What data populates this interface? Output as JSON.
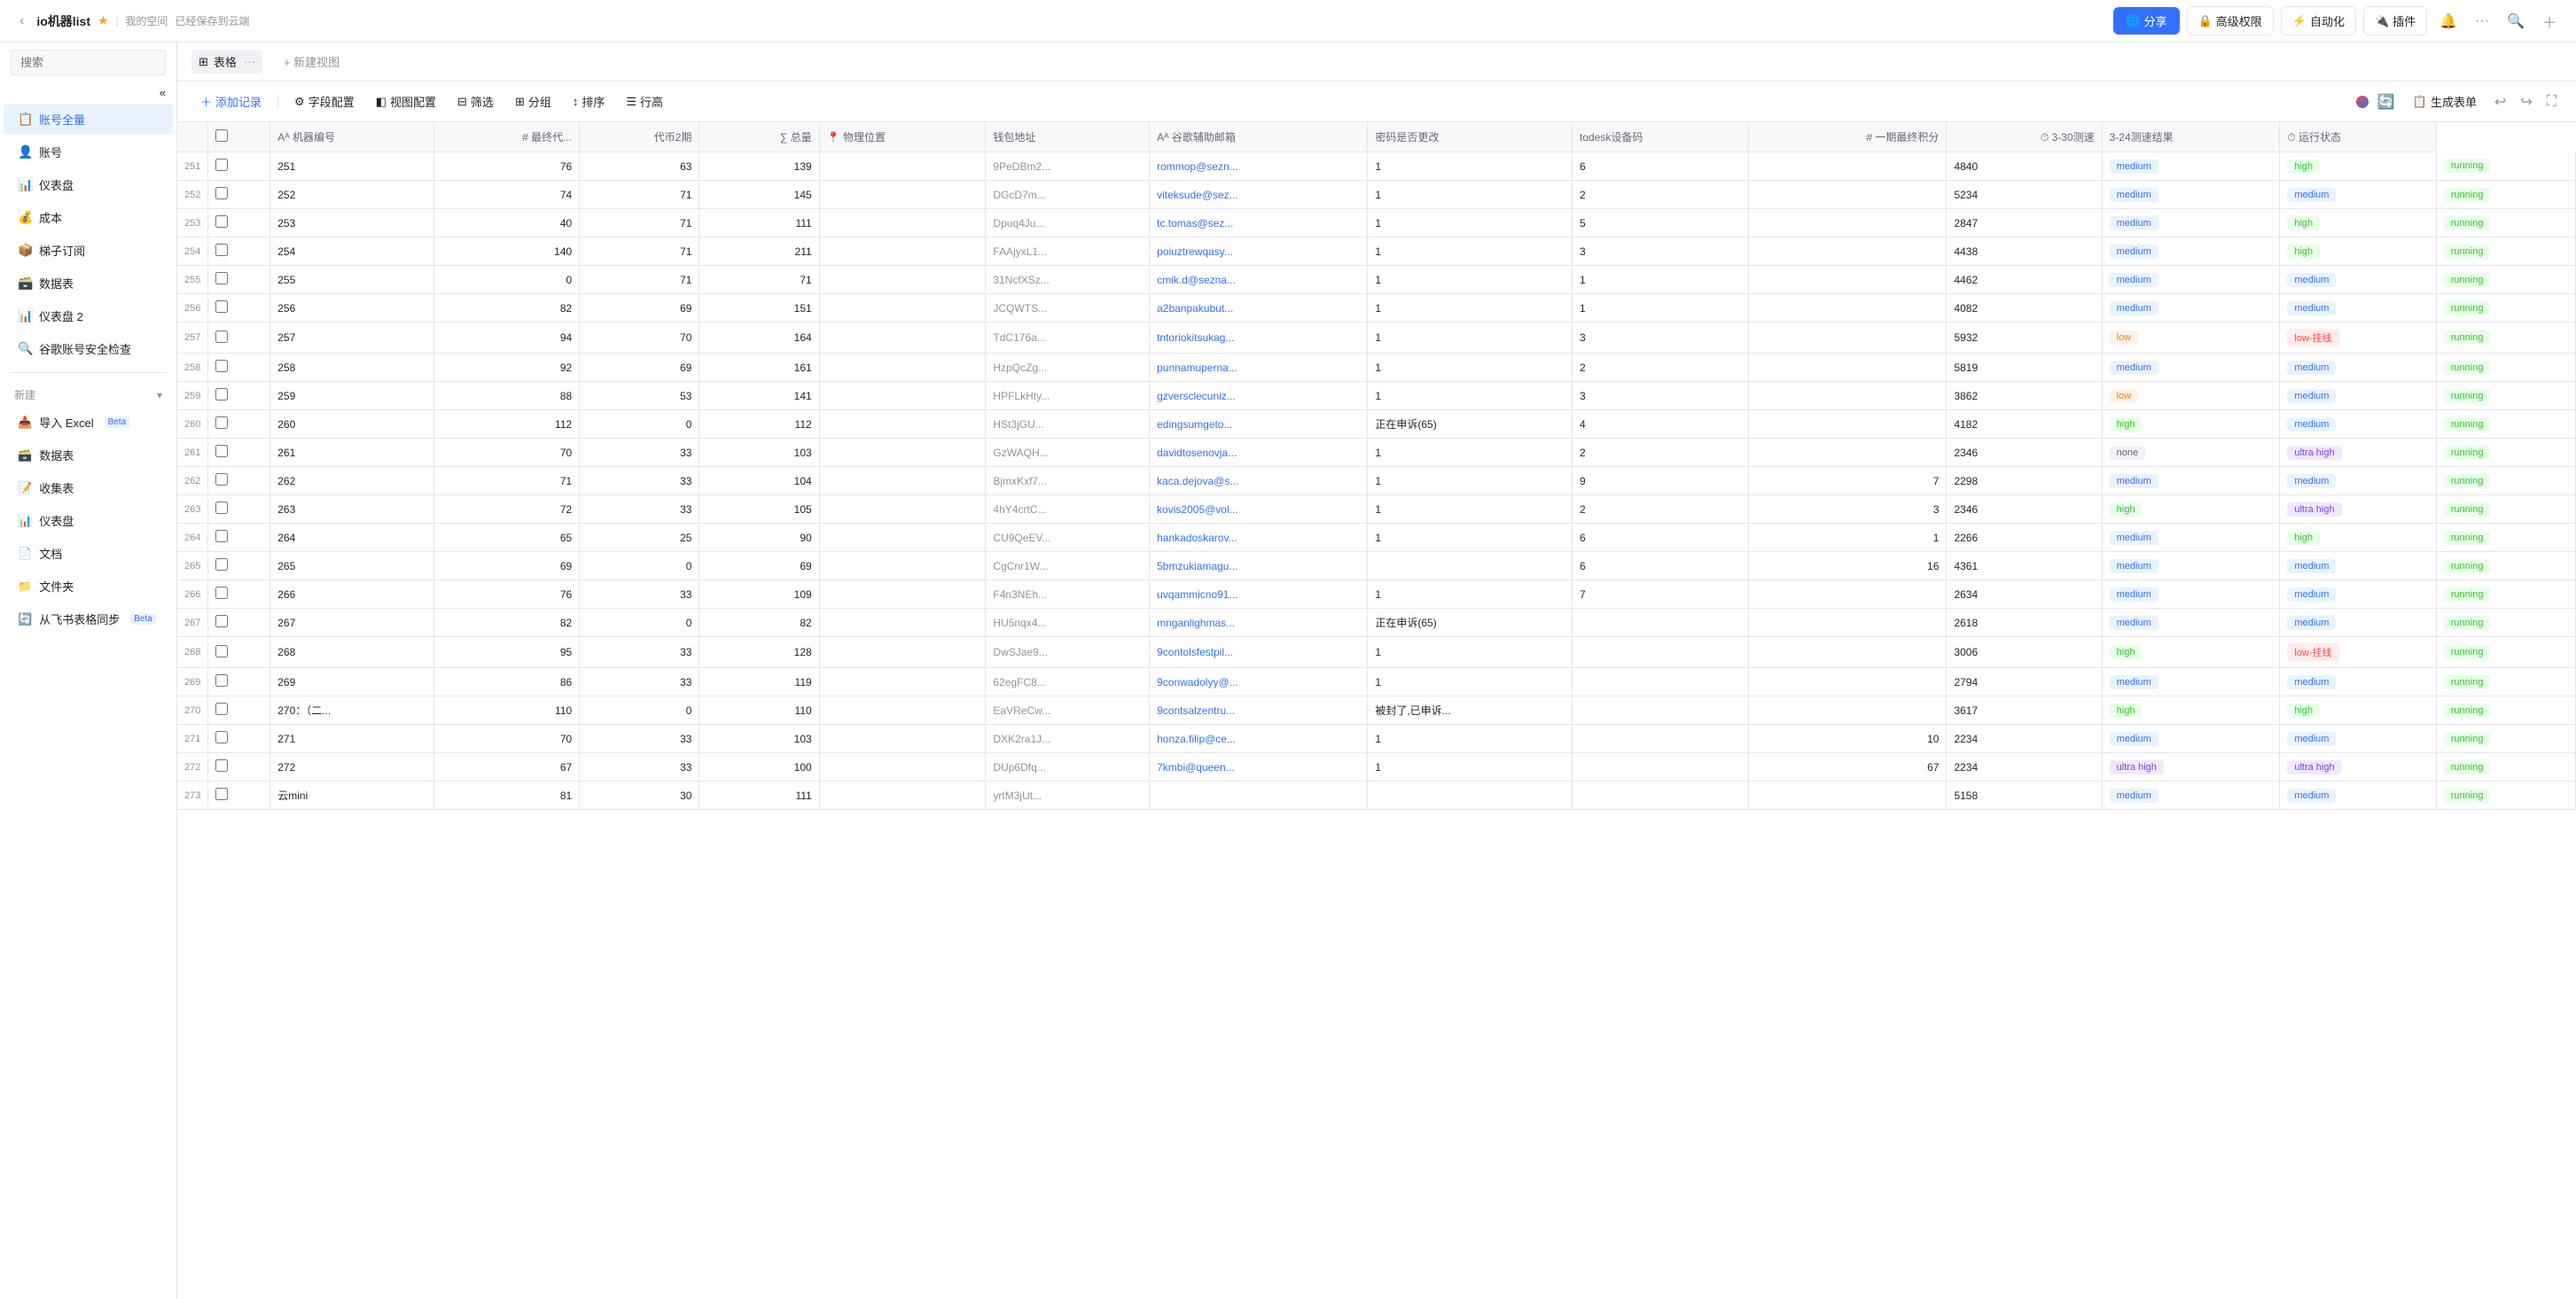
{
  "header": {
    "title": "io机器list",
    "back_label": "‹",
    "subtitle": "我的空间",
    "subtitle2": "已经保存到云端",
    "share_label": "分享",
    "advanced_label": "高级权限",
    "automate_label": "自动化",
    "plugin_label": "插件"
  },
  "sidebar": {
    "search_placeholder": "搜索",
    "items": [
      {
        "id": "account-all",
        "label": "账号全量",
        "icon": "📋",
        "active": true
      },
      {
        "id": "account",
        "label": "账号",
        "icon": "👤"
      },
      {
        "id": "dashboard",
        "label": "仪表盘",
        "icon": "📊"
      },
      {
        "id": "cost",
        "label": "成本",
        "icon": "💰"
      },
      {
        "id": "ladder-order",
        "label": "梯子订阅",
        "icon": "📦"
      },
      {
        "id": "data-table",
        "label": "数据表",
        "icon": "🗃️"
      },
      {
        "id": "dashboard2",
        "label": "仪表盘 2",
        "icon": "📊"
      },
      {
        "id": "google-check",
        "label": "谷歌账号安全检查",
        "icon": "🔍"
      }
    ],
    "new_label": "新建",
    "new_items": [
      {
        "id": "import-excel",
        "label": "导入 Excel",
        "icon": "📥",
        "tag": "Beta"
      },
      {
        "id": "data-table2",
        "label": "数据表",
        "icon": "🗃️"
      },
      {
        "id": "form",
        "label": "收集表",
        "icon": "📝"
      },
      {
        "id": "dashboard3",
        "label": "仪表盘",
        "icon": "📊"
      },
      {
        "id": "doc",
        "label": "文档",
        "icon": "📄"
      },
      {
        "id": "folder",
        "label": "文件夹",
        "icon": "📁"
      },
      {
        "id": "sync-feishu",
        "label": "从飞书表格同步",
        "icon": "🔄",
        "tag": "Beta"
      }
    ]
  },
  "view": {
    "tabs": [
      {
        "id": "table",
        "label": "表格",
        "icon": "⊞",
        "active": true
      }
    ],
    "new_view_label": "+ 新建视图"
  },
  "toolbar": {
    "add_record": "添加记录",
    "field_config": "字段配置",
    "view_config": "视图配置",
    "filter": "筛选",
    "group": "分组",
    "sort": "排序",
    "row_height": "行高",
    "generate_list": "生成表单"
  },
  "table": {
    "columns": [
      {
        "id": "machine_id",
        "label": "机器编号"
      },
      {
        "id": "latest",
        "label": "最终代..."
      },
      {
        "id": "token2",
        "label": "代币2期"
      },
      {
        "id": "total",
        "label": "总量"
      },
      {
        "id": "physical_location",
        "label": "物理位置"
      },
      {
        "id": "wallet",
        "label": "钱包地址"
      },
      {
        "id": "google_email",
        "label": "谷歌辅助邮箱"
      },
      {
        "id": "password_changed",
        "label": "密码是否更改"
      },
      {
        "id": "todesk",
        "label": "todesk设备码"
      },
      {
        "id": "last_score",
        "label": "一期最终积分"
      },
      {
        "id": "speed_3_30",
        "label": "3-30测速"
      },
      {
        "id": "test_3_24",
        "label": "3-24测速结果"
      },
      {
        "id": "run_status",
        "label": "运行状态"
      }
    ],
    "rows": [
      {
        "seq": 251,
        "machine_id": "251",
        "latest": 76,
        "token2": 63,
        "total": 139,
        "wallet": "9PeDBm2...",
        "google_email": "rommop@sezn...",
        "password_changed": "1",
        "todesk": "6",
        "last_score": "",
        "score": 4840,
        "speed": "medium",
        "test_result": "high",
        "run_status": "running"
      },
      {
        "seq": 252,
        "machine_id": "252",
        "latest": 74,
        "token2": 71,
        "total": 145,
        "wallet": "DGcD7m...",
        "google_email": "viteksude@sez...",
        "password_changed": "1",
        "todesk": "2",
        "last_score": "",
        "score": 5234,
        "speed": "medium",
        "test_result": "medium",
        "run_status": "running"
      },
      {
        "seq": 253,
        "machine_id": "253",
        "latest": 40,
        "token2": 71,
        "total": 111,
        "wallet": "Dpuq4Ju...",
        "google_email": "tc.tomas@sez...",
        "password_changed": "1",
        "todesk": "5",
        "last_score": "",
        "score": 2847,
        "speed": "medium",
        "test_result": "high",
        "run_status": "running"
      },
      {
        "seq": 254,
        "machine_id": "254",
        "latest": 140,
        "token2": 71,
        "total": 211,
        "wallet": "FAAjyxL1...",
        "google_email": "poiuztrewqasy...",
        "password_changed": "1",
        "todesk": "3",
        "last_score": "",
        "score": 4438,
        "speed": "medium",
        "test_result": "high",
        "run_status": "running"
      },
      {
        "seq": 255,
        "machine_id": "255",
        "latest": 0,
        "token2": 71,
        "total": 71,
        "wallet": "31NcfXSz...",
        "google_email": "cmik.d@sezna...",
        "password_changed": "1",
        "todesk": "1",
        "last_score": "",
        "score": 4462,
        "speed": "medium",
        "test_result": "medium",
        "run_status": "running"
      },
      {
        "seq": 256,
        "machine_id": "256",
        "latest": 82,
        "token2": 69,
        "total": 151,
        "wallet": "JCQWTS...",
        "google_email": "a2banpakubut...",
        "password_changed": "1",
        "todesk": "1",
        "last_score": "",
        "score": 4082,
        "speed": "medium",
        "test_result": "medium",
        "run_status": "running"
      },
      {
        "seq": 257,
        "machine_id": "257",
        "latest": 94,
        "token2": 70,
        "total": 164,
        "wallet": "TdC176a...",
        "google_email": "tntoriokitsukag...",
        "password_changed": "1",
        "todesk": "3",
        "last_score": "",
        "score": 5932,
        "speed": "low",
        "test_result": "low-offline",
        "run_status": "running"
      },
      {
        "seq": 258,
        "machine_id": "258",
        "latest": 92,
        "token2": 69,
        "total": 161,
        "wallet": "HzpQcZg...",
        "google_email": "punnamuperna...",
        "password_changed": "1",
        "todesk": "2",
        "last_score": "",
        "score": 5819,
        "speed": "medium",
        "test_result": "medium",
        "run_status": "running"
      },
      {
        "seq": 259,
        "machine_id": "259",
        "latest": 88,
        "token2": 53,
        "total": 141,
        "wallet": "HPFLkHty...",
        "google_email": "gzversclecuniz...",
        "password_changed": "1",
        "todesk": "3",
        "last_score": "",
        "score": 3862,
        "speed": "low",
        "test_result": "medium",
        "run_status": "running"
      },
      {
        "seq": 260,
        "machine_id": "260",
        "latest": 112,
        "token2": 0,
        "total": 112,
        "wallet": "HSt3jGU...",
        "google_email": "edingsumgeto...",
        "password_changed": "正在申诉(65)",
        "todesk": "4",
        "last_score": "",
        "score": 4182,
        "speed": "high",
        "test_result": "medium",
        "run_status": "running"
      },
      {
        "seq": 261,
        "machine_id": "261",
        "latest": 70,
        "token2": 33,
        "total": 103,
        "wallet": "GzWAQH...",
        "google_email": "davidtosenovja...",
        "password_changed": "1",
        "todesk": "2",
        "last_score": "",
        "score": 2346,
        "speed": "none",
        "test_result": "ultra high",
        "run_status": "running"
      },
      {
        "seq": 262,
        "machine_id": "262",
        "latest": 71,
        "token2": 33,
        "total": 104,
        "wallet": "BjmxKxf7...",
        "google_email": "kaca.dejova@s...",
        "password_changed": "1",
        "todesk": "9",
        "last_score": "7",
        "score": 2298,
        "speed": "medium",
        "test_result": "medium",
        "run_status": "running"
      },
      {
        "seq": 263,
        "machine_id": "263",
        "latest": 72,
        "token2": 33,
        "total": 105,
        "wallet": "4hY4crtC...",
        "google_email": "kovis2005@vol...",
        "password_changed": "1",
        "todesk": "2",
        "last_score": "3",
        "score": 2346,
        "speed": "high",
        "test_result": "ultra high",
        "run_status": "running"
      },
      {
        "seq": 264,
        "machine_id": "264",
        "latest": 65,
        "token2": 25,
        "total": 90,
        "wallet": "CU9QeEV...",
        "google_email": "hankadoskarov...",
        "password_changed": "1",
        "todesk": "6",
        "last_score": "1",
        "score": 2266,
        "speed": "medium",
        "test_result": "high",
        "run_status": "running"
      },
      {
        "seq": 265,
        "machine_id": "265",
        "latest": 69,
        "token2": 0,
        "total": 69,
        "wallet": "CgCnr1W...",
        "google_email": "5bmzukiamagu...",
        "password_changed": "",
        "todesk": "6",
        "last_score": "16",
        "score": 4361,
        "speed": "medium",
        "test_result": "medium",
        "run_status": "running"
      },
      {
        "seq": 266,
        "machine_id": "266",
        "latest": 76,
        "token2": 33,
        "total": 109,
        "wallet": "F4n3NEh...",
        "google_email": "uvqammicno91...",
        "password_changed": "1",
        "todesk": "7",
        "last_score": "",
        "score": 2634,
        "speed": "medium",
        "test_result": "medium",
        "run_status": "running"
      },
      {
        "seq": 267,
        "machine_id": "267",
        "latest": 82,
        "token2": 0,
        "total": 82,
        "wallet": "HU5nqx4...",
        "google_email": "mnganlighmas...",
        "password_changed": "正在申诉(65)",
        "todesk": "",
        "last_score": "",
        "score": 2618,
        "speed": "medium",
        "test_result": "medium",
        "run_status": "running"
      },
      {
        "seq": 268,
        "machine_id": "268",
        "latest": 95,
        "token2": 33,
        "total": 128,
        "wallet": "DwSJae9...",
        "google_email": "9contolsfestpil...",
        "password_changed": "1",
        "todesk": "",
        "last_score": "",
        "score": 3006,
        "speed": "high",
        "test_result": "low-offline",
        "run_status": "running"
      },
      {
        "seq": 269,
        "machine_id": "269",
        "latest": 86,
        "token2": 33,
        "total": 119,
        "wallet": "62egFC8...",
        "google_email": "9conwadolyy@...",
        "password_changed": "1",
        "todesk": "",
        "last_score": "",
        "score": 2794,
        "speed": "medium",
        "test_result": "medium",
        "run_status": "running"
      },
      {
        "seq": 270,
        "machine_id": "270：（二...",
        "latest": 110,
        "token2": 0,
        "total": 110,
        "wallet": "EaVReCw...",
        "google_email": "9contsalzentru...",
        "password_changed": "被封了,已申诉...",
        "todesk": "",
        "last_score": "",
        "score": 3617,
        "speed": "high",
        "test_result": "high",
        "run_status": "running"
      },
      {
        "seq": 271,
        "machine_id": "271",
        "latest": 70,
        "token2": 33,
        "total": 103,
        "wallet": "DXK2ra1J...",
        "google_email": "honza.filip@ce...",
        "password_changed": "1",
        "todesk": "",
        "last_score": "10",
        "score": 2234,
        "speed": "medium",
        "test_result": "medium",
        "run_status": "running"
      },
      {
        "seq": 272,
        "machine_id": "272",
        "latest": 67,
        "token2": 33,
        "total": 100,
        "wallet": "DUp6Dfq...",
        "google_email": "7kmbi@queen...",
        "password_changed": "1",
        "todesk": "",
        "last_score": "67",
        "score": 2234,
        "speed": "ultra high",
        "test_result": "ultra high",
        "run_status": "running"
      },
      {
        "seq": 273,
        "machine_id": "云mini",
        "latest": 81,
        "token2": 30,
        "total": 111,
        "wallet": "yrtM3jUt...",
        "google_email": "",
        "password_changed": "",
        "todesk": "",
        "last_score": "",
        "score": 5158,
        "speed": "medium",
        "test_result": "medium",
        "run_status": "running"
      }
    ]
  }
}
